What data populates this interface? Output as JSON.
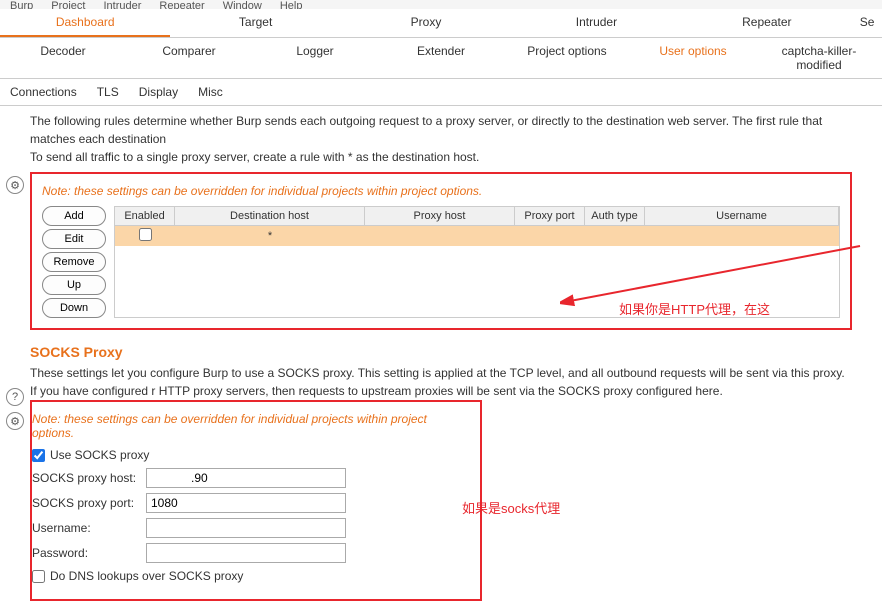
{
  "menubar": [
    "Burp",
    "Project",
    "Intruder",
    "Repeater",
    "Window",
    "Help"
  ],
  "tabs_row1": {
    "dashboard": "Dashboard",
    "target": "Target",
    "proxy": "Proxy",
    "intruder": "Intruder",
    "repeater": "Repeater",
    "se": "Se"
  },
  "tabs_row2": {
    "decoder": "Decoder",
    "comparer": "Comparer",
    "logger": "Logger",
    "extender": "Extender",
    "project_options": "Project options",
    "user_options": "User options",
    "captcha": "captcha-killer-modified"
  },
  "subtabs": {
    "connections": "Connections",
    "tls": "TLS",
    "display": "Display",
    "misc": "Misc"
  },
  "upstream": {
    "desc1": "The following rules determine whether Burp sends each outgoing request to a proxy server, or directly to the destination web server. The first rule that matches each destination",
    "desc2": "To send all traffic to a single proxy server, create a rule with * as the destination host.",
    "note": "Note: these settings can be overridden for individual projects within project options.",
    "buttons": {
      "add": "Add",
      "edit": "Edit",
      "remove": "Remove",
      "up": "Up",
      "down": "Down"
    },
    "headers": {
      "enabled": "Enabled",
      "dest": "Destination host",
      "proxy_host": "Proxy host",
      "proxy_port": "Proxy port",
      "auth_type": "Auth type",
      "username": "Username"
    },
    "row": {
      "enabled": false,
      "dest": "*",
      "proxy_host": "",
      "proxy_port": "",
      "auth_type": "",
      "username": ""
    },
    "annotation": "如果你是HTTP代理，在这"
  },
  "socks": {
    "title": "SOCKS Proxy",
    "desc": "These settings let you configure Burp to use a SOCKS proxy. This setting is applied at the TCP level, and all outbound requests will be sent via this proxy. If you have configured r HTTP proxy servers, then requests to upstream proxies will be sent via the SOCKS proxy configured here.",
    "note": "Note: these settings can be overridden for individual projects within project options.",
    "use_label": "Use SOCKS proxy",
    "use_checked": true,
    "host_label": "SOCKS proxy host:",
    "host_value": "            .90",
    "port_label": "SOCKS proxy port:",
    "port_value": "1080",
    "user_label": "Username:",
    "user_value": "",
    "pass_label": "Password:",
    "pass_value": "",
    "dns_label": "Do DNS lookups over SOCKS proxy",
    "dns_checked": false,
    "annotation": "如果是socks代理"
  }
}
